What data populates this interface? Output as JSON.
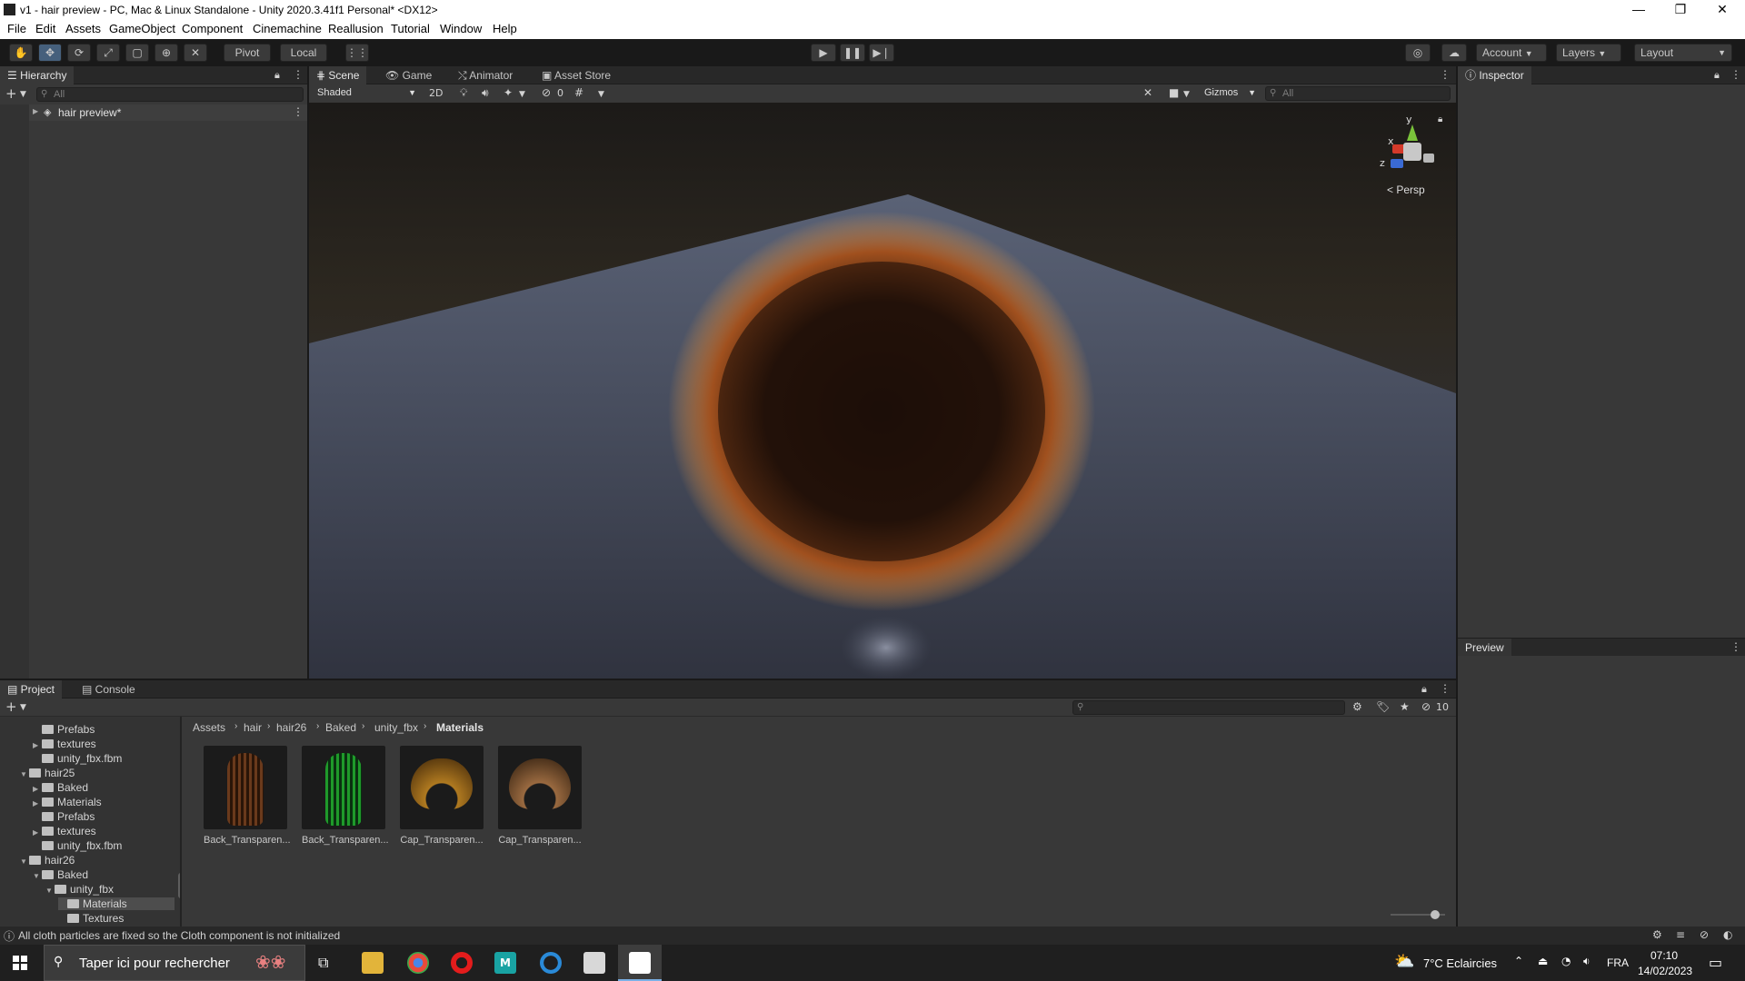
{
  "window": {
    "title": "v1 - hair preview - PC, Mac & Linux Standalone - Unity 2020.3.41f1 Personal* <DX12>",
    "minimize": "—",
    "restore": "❐",
    "close": "✕"
  },
  "menu": [
    "File",
    "Edit",
    "Assets",
    "GameObject",
    "Component",
    "Cinemachine",
    "Reallusion",
    "Tutorial",
    "Window",
    "Help"
  ],
  "toolbar": {
    "pivot": "Pivot",
    "local": "Local",
    "account": "Account",
    "layers": "Layers",
    "layout": "Layout"
  },
  "hierarchy": {
    "tab": "Hierarchy",
    "search_placeholder": "All",
    "add": "+",
    "root_item": "hair preview*"
  },
  "scene": {
    "tabs": [
      "Scene",
      "Game",
      "Animator",
      "Asset Store"
    ],
    "shading": "Shaded",
    "mode_2d": "2D",
    "hidden_count": "0",
    "gizmos": "Gizmos",
    "search_placeholder": "All",
    "persp": "Persp",
    "axis_y": "y",
    "axis_x": "x",
    "axis_z": "z"
  },
  "inspector": {
    "tab": "Inspector",
    "preview": "Preview"
  },
  "project": {
    "tabs": [
      "Project",
      "Console"
    ],
    "badge_count": "10",
    "tree": [
      {
        "label": "Prefabs",
        "depth": 2,
        "arrow": ""
      },
      {
        "label": "textures",
        "depth": 2,
        "arrow": "▶"
      },
      {
        "label": "unity_fbx.fbm",
        "depth": 2,
        "arrow": ""
      },
      {
        "label": "hair25",
        "depth": 1,
        "arrow": "▼"
      },
      {
        "label": "Baked",
        "depth": 2,
        "arrow": "▶"
      },
      {
        "label": "Materials",
        "depth": 2,
        "arrow": "▶"
      },
      {
        "label": "Prefabs",
        "depth": 2,
        "arrow": ""
      },
      {
        "label": "textures",
        "depth": 2,
        "arrow": "▶"
      },
      {
        "label": "unity_fbx.fbm",
        "depth": 2,
        "arrow": ""
      },
      {
        "label": "hair26",
        "depth": 1,
        "arrow": "▼"
      },
      {
        "label": "Baked",
        "depth": 2,
        "arrow": "▼"
      },
      {
        "label": "unity_fbx",
        "depth": 3,
        "arrow": "▼"
      },
      {
        "label": "Materials",
        "depth": 4,
        "arrow": ""
      },
      {
        "label": "Textures",
        "depth": 4,
        "arrow": ""
      }
    ],
    "breadcrumb": [
      "Assets",
      "hair",
      "hair26",
      "Baked",
      "unity_fbx",
      "Materials"
    ],
    "assets": [
      {
        "label": "Back_Transparen...",
        "color": "#a05a2c"
      },
      {
        "label": "Back_Transparen...",
        "color": "#1f9a2a"
      },
      {
        "label": "Cap_Transparen...",
        "color": "#b07a20"
      },
      {
        "label": "Cap_Transparen...",
        "color": "#9a6a40"
      }
    ]
  },
  "status": {
    "message": "All cloth particles are fixed so the Cloth component is not initialized"
  },
  "taskbar": {
    "search_placeholder": "Taper ici pour rechercher",
    "weather": "7°C  Eclaircies",
    "language": "FRA",
    "time": "07:10",
    "date": "14/02/2023"
  }
}
